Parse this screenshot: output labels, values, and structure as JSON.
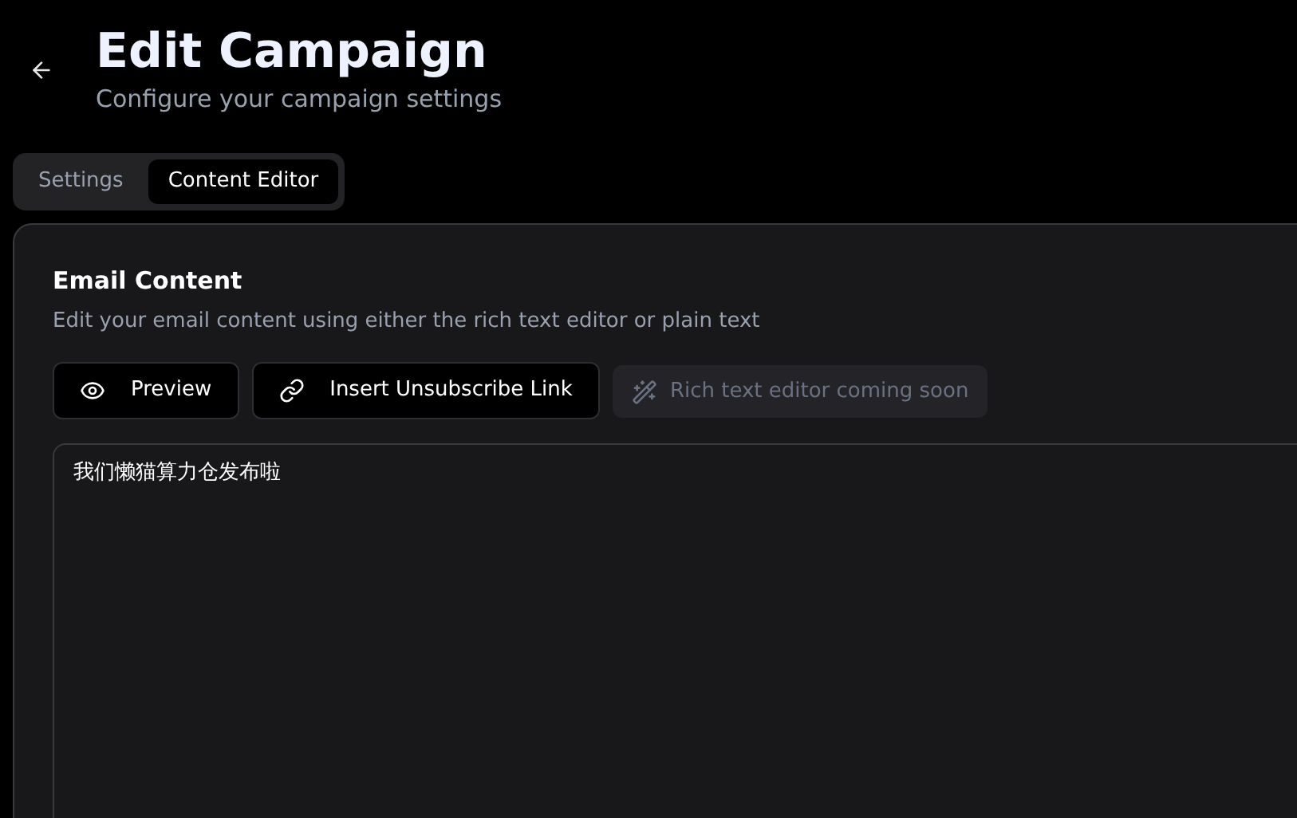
{
  "header": {
    "title": "Edit Campaign",
    "subtitle": "Configure your campaign settings"
  },
  "tabs": [
    {
      "label": "Settings",
      "selected": false
    },
    {
      "label": "Content Editor",
      "selected": true
    }
  ],
  "card": {
    "title": "Email Content",
    "description": "Edit your email content using either the rich text editor or plain text",
    "buttons": [
      {
        "kind": "eye",
        "label": "Preview",
        "disabled": false
      },
      {
        "kind": "link",
        "label": "Insert Unsubscribe Link",
        "disabled": false
      },
      {
        "kind": "wand",
        "label": "Rich text editor coming soon",
        "disabled": true
      }
    ],
    "content": "我们懒猫算力仓发布啦"
  }
}
